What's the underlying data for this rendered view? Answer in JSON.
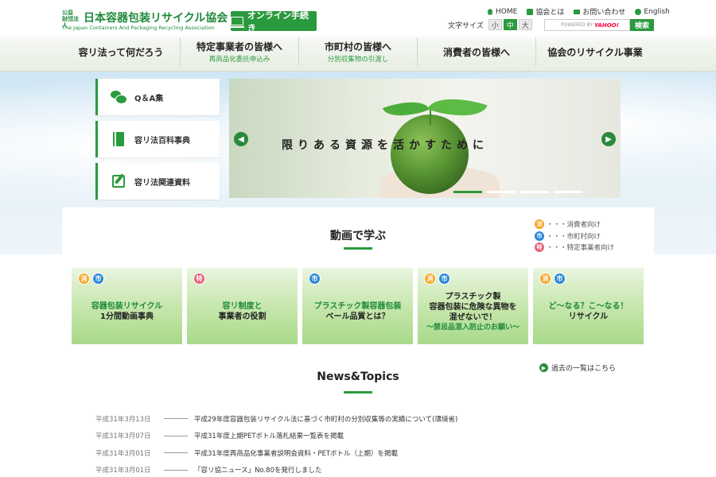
{
  "header": {
    "logo": {
      "small": "公益\n財団法人",
      "main": "日本容器包装リサイクル協会",
      "sub": "The Japan Containers And Packaging Recycling Association"
    },
    "online_button": "オンライン手続き",
    "util_links": [
      {
        "label": "HOME",
        "icon": "home-icon"
      },
      {
        "label": "協会とは",
        "icon": "document-icon"
      },
      {
        "label": "お問い合わせ",
        "icon": "mail-icon"
      },
      {
        "label": "English",
        "icon": "globe-icon"
      }
    ],
    "font_size": {
      "label": "文字サイズ",
      "options": [
        "小",
        "中",
        "大"
      ],
      "active": "中"
    },
    "search": {
      "powered": "POWERED BY",
      "provider": "YAHOO!",
      "button": "検索"
    },
    "nav": [
      {
        "main": "容リ法って何だろう",
        "sub": ""
      },
      {
        "main": "特定事業者の皆様へ",
        "sub": "再商品化委託申込み"
      },
      {
        "main": "市町村の皆様へ",
        "sub": "分別収集物の引渡し"
      },
      {
        "main": "消費者の皆様へ",
        "sub": ""
      },
      {
        "main": "協会のリサイクル事業",
        "sub": ""
      }
    ]
  },
  "side_menu": [
    {
      "label": "Q＆A集",
      "icon": "chat-icon"
    },
    {
      "label": "容リ法百科事典",
      "icon": "book-icon"
    },
    {
      "label": "容リ法関連資料",
      "icon": "edit-icon"
    }
  ],
  "slider": {
    "caption": "限りある資源を活かすために",
    "slide_count": 4,
    "active_slide": 1
  },
  "video": {
    "title": "動画で学ぶ",
    "legend": [
      {
        "badge": "消",
        "color": "orange",
        "label": "・・・消費者向け"
      },
      {
        "badge": "市",
        "color": "blue",
        "label": "・・・市町村向け"
      },
      {
        "badge": "特",
        "color": "pink",
        "label": "・・・特定事業者向け"
      }
    ],
    "cards": [
      {
        "badges": [
          {
            "t": "消",
            "c": "orange"
          },
          {
            "t": "市",
            "c": "blue"
          }
        ],
        "l1": "容器包装リサイクル",
        "l2": "1分間動画事典",
        "l3": ""
      },
      {
        "badges": [
          {
            "t": "特",
            "c": "pink"
          }
        ],
        "l1": "容リ制度と",
        "l2": "事業者の役割",
        "l3": ""
      },
      {
        "badges": [
          {
            "t": "市",
            "c": "blue"
          }
        ],
        "l1": "プラスチック製容器包装",
        "l2": "ベール品質とは？",
        "l3": ""
      },
      {
        "badges": [
          {
            "t": "消",
            "c": "orange"
          },
          {
            "t": "市",
            "c": "blue"
          }
        ],
        "l1": "",
        "l2": "プラスチック製\n容器包装に危険な異物を\n混ぜないで！",
        "l3": "～禁忌品混入防止のお願い～"
      },
      {
        "badges": [
          {
            "t": "消",
            "c": "orange"
          },
          {
            "t": "市",
            "c": "blue"
          }
        ],
        "l1": "ど～なる？こ～なる！",
        "l2": "リサイクル",
        "l3": ""
      }
    ]
  },
  "news": {
    "title": "News&Topics",
    "more": "過去の一覧はこちら",
    "items": [
      {
        "date": "平成31年3月13日",
        "text": "平成29年度容器包装リサイクル法に基づく市町村の分別収集等の実績について(環境省)"
      },
      {
        "date": "平成31年3月07日",
        "text": "平成31年度上期PETボトル落札結果一覧表を掲載"
      },
      {
        "date": "平成31年3月01日",
        "text": "平成31年度再商品化事業者説明会資料・PETボトル（上期）を掲載"
      },
      {
        "date": "平成31年3月01日",
        "text": "「容リ協ニュース」No.80を発行しました"
      }
    ]
  },
  "colors": {
    "accent": "#2a9a3e",
    "consumer": "#f5a623",
    "municipal": "#2b86d6",
    "business": "#e6607a"
  }
}
